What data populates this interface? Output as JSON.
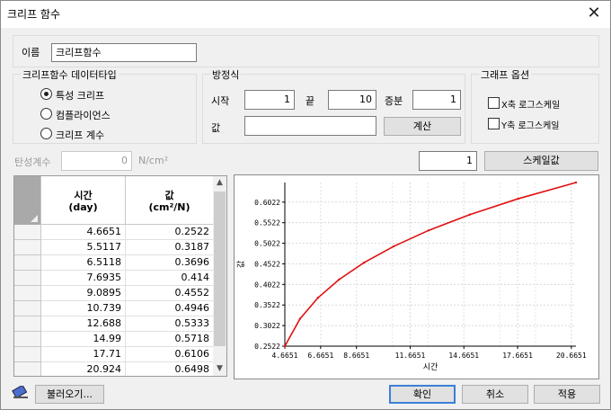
{
  "window": {
    "title": "크리프 함수",
    "close_glyph": "✕"
  },
  "name": {
    "label": "이름",
    "value": "크리프함수"
  },
  "datatype": {
    "legend": "크리프함수 데이터타입",
    "options": [
      {
        "label": "특성 크리프",
        "checked": true
      },
      {
        "label": "컴플라이언스",
        "checked": false
      },
      {
        "label": "크리프 계수",
        "checked": false
      }
    ]
  },
  "equation": {
    "legend": "방정식",
    "start_label": "시작",
    "start_value": "1",
    "end_label": "끝",
    "end_value": "10",
    "incr_label": "증분",
    "incr_value": "1",
    "value_label": "값",
    "value_value": "",
    "calc_button": "계산"
  },
  "graph_options": {
    "legend": "그래프 옵션",
    "x_log_label": "X축 로그스케일",
    "x_log_checked": false,
    "y_log_label": "Y축 로그스케일",
    "y_log_checked": false
  },
  "elastic": {
    "label": "탄성계수",
    "value": "0",
    "unit": "N/cm²"
  },
  "scale": {
    "value": "1",
    "button": "스케일값"
  },
  "table": {
    "col1_line1": "시간",
    "col1_line2": "(day)",
    "col2_line1": "값",
    "col2_line2": "(cm²/N)",
    "rows": [
      [
        "4.6651",
        "0.2522"
      ],
      [
        "5.5117",
        "0.3187"
      ],
      [
        "6.5118",
        "0.3696"
      ],
      [
        "7.6935",
        "0.414"
      ],
      [
        "9.0895",
        "0.4552"
      ],
      [
        "10.739",
        "0.4946"
      ],
      [
        "12.688",
        "0.5333"
      ],
      [
        "14.99",
        "0.5718"
      ],
      [
        "17.71",
        "0.6106"
      ],
      [
        "20.924",
        "0.6498"
      ]
    ]
  },
  "footer": {
    "load_button": "불러오기...",
    "ok_button": "확인",
    "cancel_button": "취소",
    "apply_button": "적용",
    "eraser_icon": "eraser-icon"
  },
  "chart_data": {
    "type": "line",
    "xlabel": "시간",
    "ylabel": "값",
    "x": [
      4.6651,
      5.5117,
      6.5118,
      7.6935,
      9.0895,
      10.739,
      12.688,
      14.99,
      17.71,
      20.924
    ],
    "series": [
      {
        "values": [
          0.2522,
          0.3187,
          0.3696,
          0.414,
          0.4552,
          0.4946,
          0.5333,
          0.5718,
          0.6106,
          0.6498
        ]
      }
    ],
    "x_ticks": [
      "4.6651",
      "6.6651",
      "8.6651",
      "11.6651",
      "14.6651",
      "17.6651",
      "20.6651"
    ],
    "x_tick_values": [
      4.6651,
      6.6651,
      8.6651,
      11.6651,
      14.6651,
      17.6651,
      20.6651
    ],
    "y_ticks": [
      "0.2522",
      "0.3022",
      "0.3522",
      "0.4022",
      "0.4522",
      "0.5022",
      "0.5522",
      "0.6022"
    ],
    "y_tick_values": [
      0.2522,
      0.3022,
      0.3522,
      0.4022,
      0.4522,
      0.5022,
      0.5522,
      0.6022
    ],
    "xlim": [
      4.6651,
      20.924
    ],
    "ylim": [
      0.2522,
      0.6498
    ],
    "grid": true,
    "line_color": "#e01010"
  }
}
